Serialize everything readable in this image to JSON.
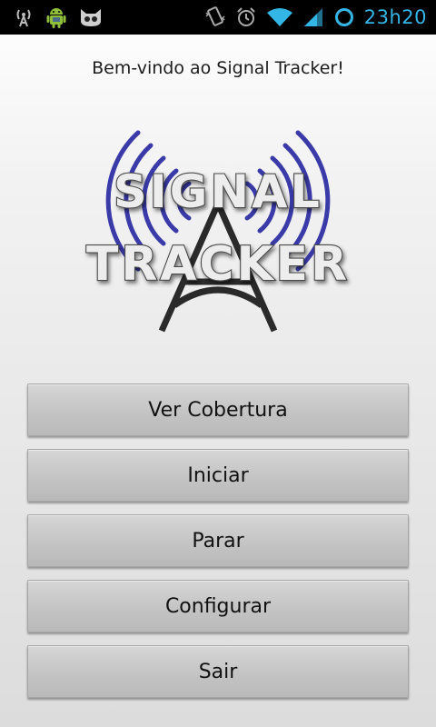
{
  "status_bar": {
    "time": "23h20",
    "left_icons": [
      "signal-broadcast-icon",
      "android-robot-icon",
      "cat-face-icon"
    ],
    "right_icons": [
      "vibrate-icon",
      "alarm-icon",
      "wifi-icon",
      "cell-signal-icon",
      "sync-ring-icon"
    ],
    "accent_color": "#33b5e5"
  },
  "welcome_text": "Bem-vindo ao Signal Tracker!",
  "logo": {
    "line1": "SIGNAL",
    "line2": "TRACKER",
    "wave_color": "#3a3aa8"
  },
  "menu": {
    "buttons": [
      {
        "label": "Ver Cobertura"
      },
      {
        "label": "Iniciar"
      },
      {
        "label": "Parar"
      },
      {
        "label": "Configurar"
      },
      {
        "label": "Sair"
      }
    ]
  }
}
